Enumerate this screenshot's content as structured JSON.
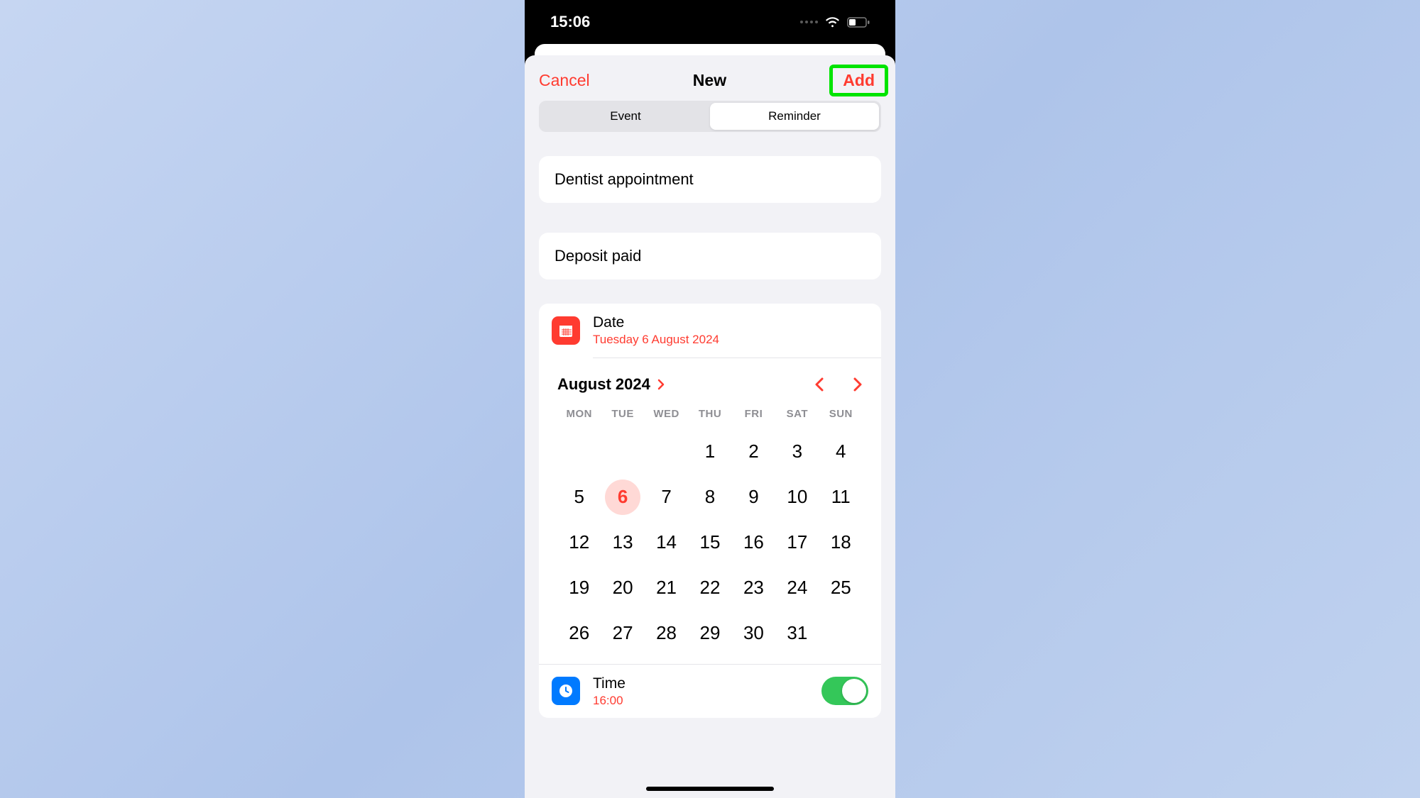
{
  "status": {
    "time": "15:06"
  },
  "nav": {
    "cancel": "Cancel",
    "title": "New",
    "add": "Add"
  },
  "seg": {
    "event": "Event",
    "reminder": "Reminder"
  },
  "fields": {
    "title": "Dentist appointment",
    "notes": "Deposit paid"
  },
  "date": {
    "label": "Date",
    "value": "Tuesday 6 August 2024"
  },
  "time": {
    "label": "Time",
    "value": "16:00"
  },
  "cal": {
    "month": "August 2024",
    "dow": [
      "MON",
      "TUE",
      "WED",
      "THU",
      "FRI",
      "SAT",
      "SUN"
    ],
    "leading_blanks": 3,
    "days": 31,
    "selected": 6
  }
}
